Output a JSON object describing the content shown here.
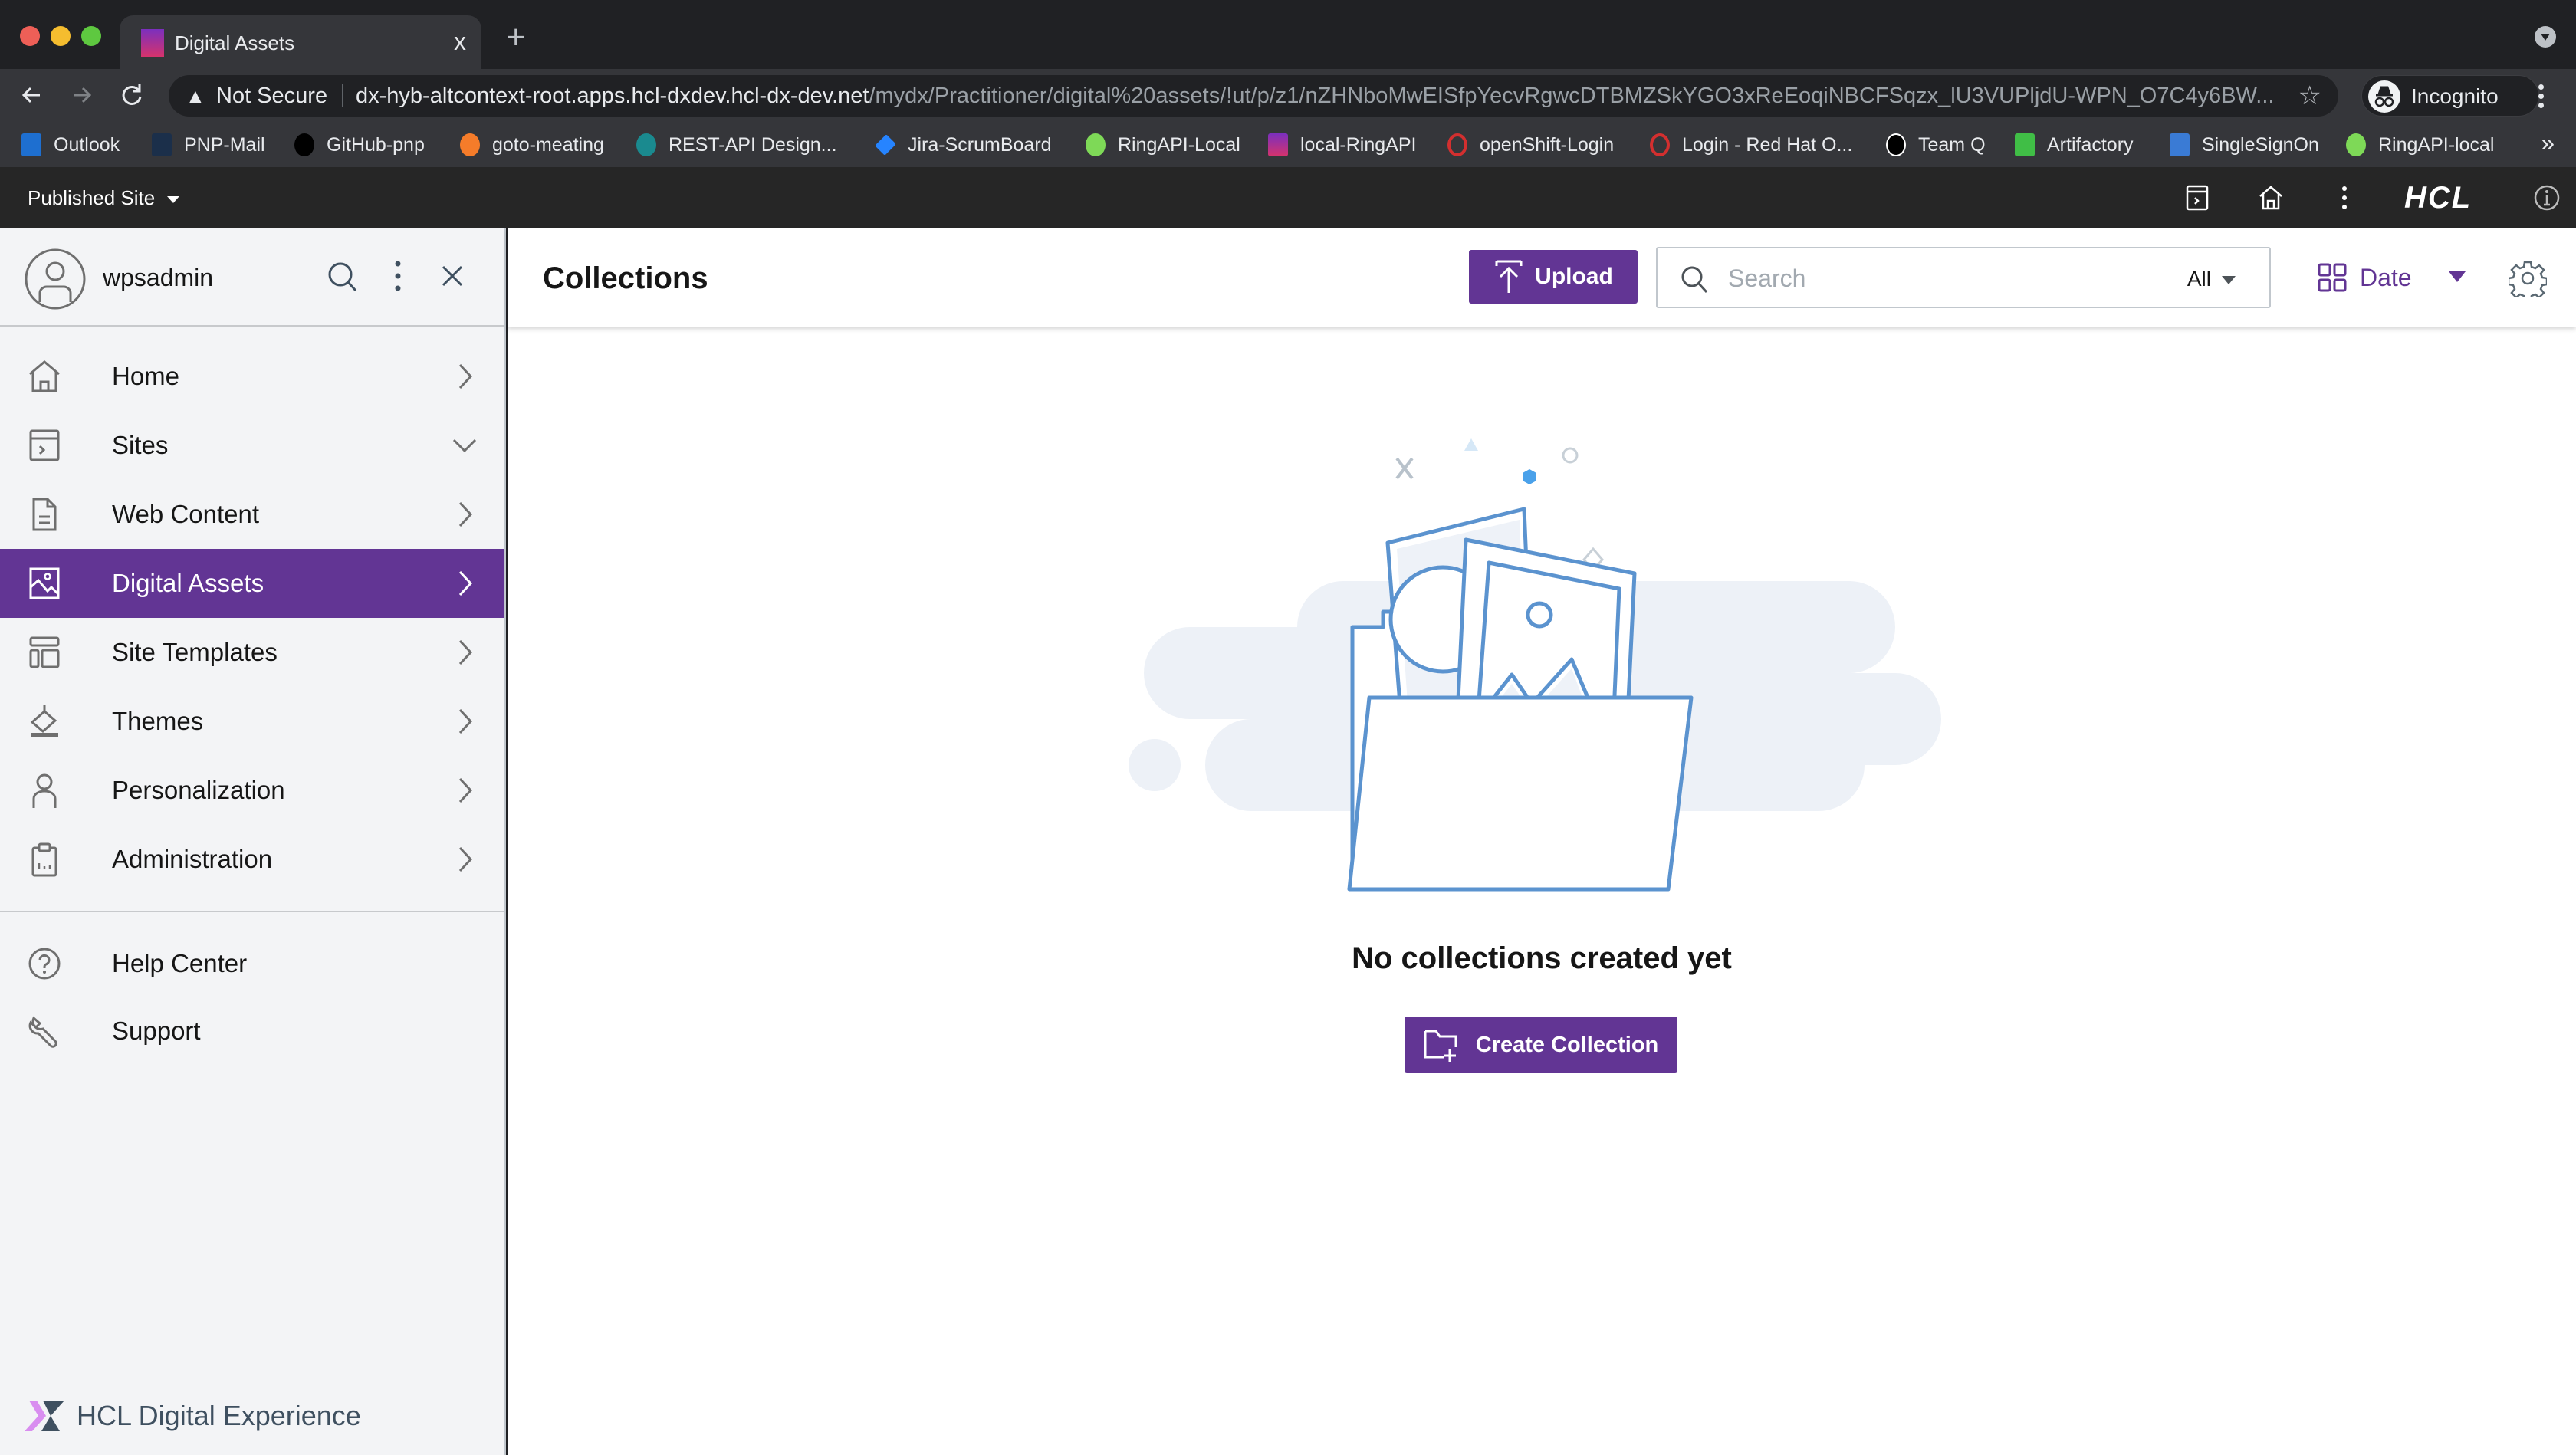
{
  "browser": {
    "tab": {
      "title": "Digital Assets",
      "close_label": "x"
    },
    "new_tab_label": "+",
    "omnibox": {
      "security_label": "Not Secure",
      "url_host": "dx-hyb-altcontext-root.apps.hcl-dxdev.hcl-dx-dev.net",
      "url_path": "/mydx/Practitioner/digital%20assets/!ut/p/z1/nZHNboMwEISfpYecvRgwcDTBMZSkYGO3xReEoqiNBCFSqzx_lU3VUPljdU-WPN_O7C4y6BW..."
    },
    "profile_label": "Incognito",
    "bookmarks": [
      {
        "label": "Outlook",
        "icon": "outlook-icon",
        "color": "#1e6fd0"
      },
      {
        "label": "PNP-Mail",
        "icon": "pnp-mail-icon",
        "color": "#1b2f4a"
      },
      {
        "label": "GitHub-pnp",
        "icon": "github-icon",
        "color": "#000000"
      },
      {
        "label": "goto-meating",
        "icon": "gotomeeting-icon",
        "color": "#f57c2a"
      },
      {
        "label": "REST-API Design...",
        "icon": "sharepoint-icon",
        "color": "#1a8a8f"
      },
      {
        "label": "Jira-ScrumBoard",
        "icon": "jira-icon",
        "color": "#2684ff"
      },
      {
        "label": "RingAPI-Local",
        "icon": "api-icon",
        "color": "#7ed957"
      },
      {
        "label": "local-RingAPI",
        "icon": "hcl-dx-icon",
        "color": "#9b2fbe"
      },
      {
        "label": "openShift-Login",
        "icon": "openshift-icon",
        "color": "#d32f2f"
      },
      {
        "label": "Login - Red Hat O...",
        "icon": "openshift-icon",
        "color": "#d32f2f"
      },
      {
        "label": "Team Q",
        "icon": "github-icon",
        "color": "#000000"
      },
      {
        "label": "Artifactory",
        "icon": "artifactory-icon",
        "color": "#40be46"
      },
      {
        "label": "SingleSignOn",
        "icon": "sso-icon",
        "color": "#3a7bd5"
      },
      {
        "label": "RingAPI-local",
        "icon": "api-icon",
        "color": "#7ed957"
      }
    ],
    "bookmarks_more": "»"
  },
  "dx_toolbar": {
    "site_selector": "Published Site",
    "brand": "HCL"
  },
  "sidebar": {
    "username": "wpsadmin",
    "nav": [
      {
        "label": "Home",
        "icon": "home-icon",
        "chevron": "right",
        "active": false
      },
      {
        "label": "Sites",
        "icon": "sites-icon",
        "chevron": "down",
        "active": false
      },
      {
        "label": "Web Content",
        "icon": "document-icon",
        "chevron": "right",
        "active": false
      },
      {
        "label": "Digital Assets",
        "icon": "image-icon",
        "chevron": "right",
        "active": true
      },
      {
        "label": "Site Templates",
        "icon": "template-icon",
        "chevron": "right",
        "active": false
      },
      {
        "label": "Themes",
        "icon": "paint-bucket-icon",
        "chevron": "right",
        "active": false
      },
      {
        "label": "Personalization",
        "icon": "person-icon",
        "chevron": "right",
        "active": false
      },
      {
        "label": "Administration",
        "icon": "clipboard-icon",
        "chevron": "right",
        "active": false
      }
    ],
    "secondary": [
      {
        "label": "Help Center",
        "icon": "help-icon"
      },
      {
        "label": "Support",
        "icon": "wrench-icon"
      }
    ],
    "footer_brand": "HCL Digital Experience"
  },
  "main": {
    "title": "Collections",
    "upload_label": "Upload",
    "search": {
      "placeholder": "Search",
      "value": ""
    },
    "filter_value": "All",
    "sort_label": "Date",
    "empty_state": {
      "message": "No collections created yet",
      "cta_label": "Create Collection"
    }
  },
  "colors": {
    "accent": "#623594",
    "sidebar_bg": "#f3f4f6",
    "illustration_stroke": "#5b93cf",
    "illustration_cloud": "#edf1f7"
  }
}
